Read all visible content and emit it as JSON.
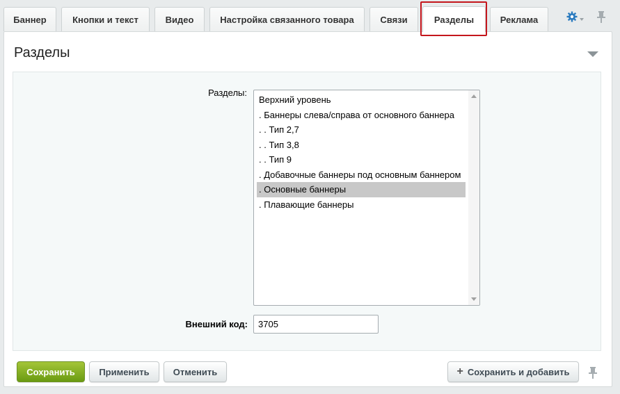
{
  "tabs": [
    {
      "label": "Баннер"
    },
    {
      "label": "Кнопки и текст"
    },
    {
      "label": "Видео"
    },
    {
      "label": "Настройка связанного товара"
    },
    {
      "label": "Связи"
    },
    {
      "label": "Разделы",
      "active": true
    },
    {
      "label": "Реклама"
    }
  ],
  "tab_tools": {
    "settings_icon": "gear-icon",
    "pin_icon": "pin-icon"
  },
  "panel": {
    "title": "Разделы",
    "collapse_icon": "triangle-down-icon"
  },
  "form": {
    "sections_label": "Разделы:",
    "sections_options": [
      {
        "text": "Верхний уровень"
      },
      {
        "text": ". Баннеры слева/справа от основного баннера"
      },
      {
        "text": ". . Тип 2,7"
      },
      {
        "text": ". . Тип 3,8"
      },
      {
        "text": ". . Тип 9"
      },
      {
        "text": ". Добавочные баннеры под основным баннером"
      },
      {
        "text": ". Основные баннеры",
        "selected": true
      },
      {
        "text": ". Плавающие баннеры"
      }
    ],
    "external_code_label": "Внешний код:",
    "external_code_value": "3705"
  },
  "footer": {
    "save_label": "Сохранить",
    "apply_label": "Применить",
    "cancel_label": "Отменить",
    "save_add_label": "Сохранить и добавить",
    "pin_icon": "pin-icon"
  },
  "colors": {
    "highlight_border": "#c4161c",
    "save_button": "#8bb227",
    "selected_option": "#c8c8c8"
  }
}
